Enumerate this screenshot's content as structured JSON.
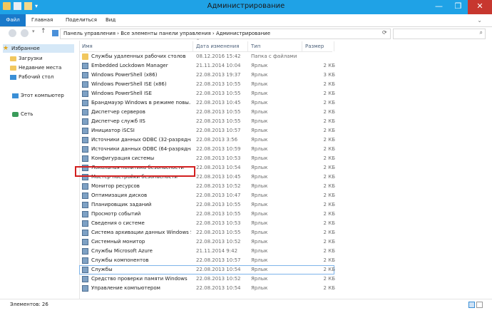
{
  "window": {
    "title": "Администрирование"
  },
  "window_buttons": {
    "minimize": "—",
    "maximize": "❐",
    "close": "✕"
  },
  "ribbon": {
    "tabs": [
      "Файл",
      "Главная",
      "Поделиться",
      "Вид"
    ]
  },
  "address": {
    "path": "Панель управления  ›  Все элементы панели управления  ›  Администрирование"
  },
  "nav": {
    "favorites": "Избранное",
    "favorites_items": [
      "Загрузки",
      "Недавние места",
      "Рабочий стол"
    ],
    "computer": "Этот компьютер",
    "network": "Сеть"
  },
  "columns": {
    "name": "Имя",
    "date": "Дата изменения",
    "type": "Тип",
    "size": "Размер"
  },
  "files": [
    {
      "name": "Службы удаленных рабочих столов",
      "date": "08.12.2016 15:42",
      "type": "Папка с файлами",
      "size": "",
      "icon": "folder-icon"
    },
    {
      "name": "Embedded Lockdown Manager",
      "date": "21.11.2014 10:04",
      "type": "Ярлык",
      "size": "2 КБ",
      "icon": "shortcut-icon"
    },
    {
      "name": "Windows PowerShell (x86)",
      "date": "22.08.2013 19:37",
      "type": "Ярлык",
      "size": "3 КБ",
      "icon": "shortcut-icon"
    },
    {
      "name": "Windows PowerShell ISE (x86)",
      "date": "22.08.2013 10:55",
      "type": "Ярлык",
      "size": "2 КБ",
      "icon": "shortcut-icon"
    },
    {
      "name": "Windows PowerShell ISE",
      "date": "22.08.2013 10:55",
      "type": "Ярлык",
      "size": "2 КБ",
      "icon": "shortcut-icon"
    },
    {
      "name": "Брандмауэр Windows в режиме повы...",
      "date": "22.08.2013 10:45",
      "type": "Ярлык",
      "size": "2 КБ",
      "icon": "shortcut-icon"
    },
    {
      "name": "Диспетчер серверов",
      "date": "22.08.2013 10:55",
      "type": "Ярлык",
      "size": "2 КБ",
      "icon": "shortcut-icon"
    },
    {
      "name": "Диспетчер служб IIS",
      "date": "22.08.2013 10:55",
      "type": "Ярлык",
      "size": "2 КБ",
      "icon": "shortcut-icon"
    },
    {
      "name": "Инициатор iSCSI",
      "date": "22.08.2013 10:57",
      "type": "Ярлык",
      "size": "2 КБ",
      "icon": "shortcut-icon"
    },
    {
      "name": "Источники данных ODBC (32-разрядна...",
      "date": "22.08.2013 3:56",
      "type": "Ярлык",
      "size": "2 КБ",
      "icon": "shortcut-icon"
    },
    {
      "name": "Источники данных ODBC (64-разрядна...",
      "date": "22.08.2013 10:59",
      "type": "Ярлык",
      "size": "2 КБ",
      "icon": "shortcut-icon"
    },
    {
      "name": "Конфигурация системы",
      "date": "22.08.2013 10:53",
      "type": "Ярлык",
      "size": "2 КБ",
      "icon": "shortcut-icon"
    },
    {
      "name": "Локальная политика безопасности",
      "date": "22.08.2013 10:54",
      "type": "Ярлык",
      "size": "2 КБ",
      "icon": "shortcut-icon"
    },
    {
      "name": "Мастер настройки безопасности",
      "date": "22.08.2013 10:45",
      "type": "Ярлык",
      "size": "2 КБ",
      "icon": "shortcut-icon"
    },
    {
      "name": "Монитор ресурсов",
      "date": "22.08.2013 10:52",
      "type": "Ярлык",
      "size": "2 КБ",
      "icon": "shortcut-icon"
    },
    {
      "name": "Оптимизация дисков",
      "date": "22.08.2013 10:47",
      "type": "Ярлык",
      "size": "2 КБ",
      "icon": "shortcut-icon"
    },
    {
      "name": "Планировщик заданий",
      "date": "22.08.2013 10:55",
      "type": "Ярлык",
      "size": "2 КБ",
      "icon": "shortcut-icon"
    },
    {
      "name": "Просмотр событий",
      "date": "22.08.2013 10:55",
      "type": "Ярлык",
      "size": "2 КБ",
      "icon": "shortcut-icon"
    },
    {
      "name": "Сведения о системе",
      "date": "22.08.2013 10:53",
      "type": "Ярлык",
      "size": "2 КБ",
      "icon": "shortcut-icon"
    },
    {
      "name": "Система архивации данных Windows S...",
      "date": "22.08.2013 10:55",
      "type": "Ярлык",
      "size": "2 КБ",
      "icon": "shortcut-icon"
    },
    {
      "name": "Системный монитор",
      "date": "22.08.2013 10:52",
      "type": "Ярлык",
      "size": "2 КБ",
      "icon": "shortcut-icon"
    },
    {
      "name": "Службы Microsoft Azure",
      "date": "21.11.2014 9:42",
      "type": "Ярлык",
      "size": "2 КБ",
      "icon": "shortcut-icon"
    },
    {
      "name": "Службы компонентов",
      "date": "22.08.2013 10:57",
      "type": "Ярлык",
      "size": "2 КБ",
      "icon": "shortcut-icon"
    },
    {
      "name": "Службы",
      "date": "22.08.2013 10:54",
      "type": "Ярлык",
      "size": "2 КБ",
      "icon": "shortcut-icon"
    },
    {
      "name": "Средство проверки памяти Windows",
      "date": "22.08.2013 10:52",
      "type": "Ярлык",
      "size": "2 КБ",
      "icon": "shortcut-icon"
    },
    {
      "name": "Управление компьютером",
      "date": "22.08.2013 10:54",
      "type": "Ярлык",
      "size": "2 КБ",
      "icon": "shortcut-icon"
    }
  ],
  "highlighted_item": "Локальная политика безопасности",
  "focused_item": "Службы",
  "status": {
    "items_count": "Элементов: 26"
  }
}
